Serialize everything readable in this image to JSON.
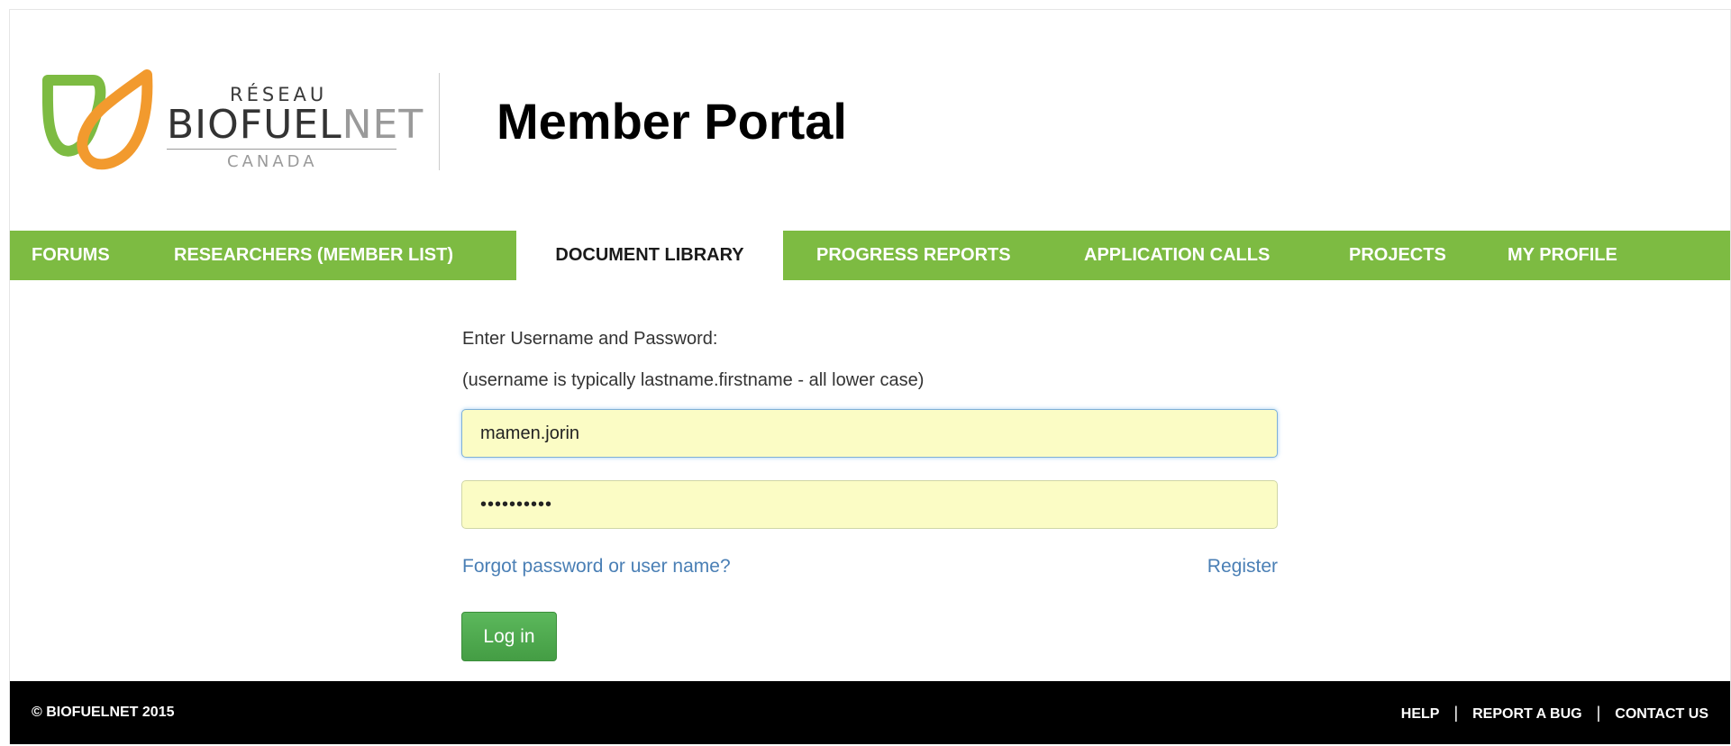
{
  "header": {
    "logo": {
      "reseau": "RÉSEAU",
      "brand_main": "BIOFUEL",
      "brand_net": "NET",
      "canada": "CANADA",
      "colors": {
        "green": "#7dbb42",
        "orange": "#f29a2e"
      }
    },
    "title": "Member Portal"
  },
  "nav": {
    "color": "#7dbb42",
    "items": [
      {
        "label": "FORUMS",
        "active": false
      },
      {
        "label": "RESEARCHERS (MEMBER LIST)",
        "active": false
      },
      {
        "label": "DOCUMENT LIBRARY",
        "active": true
      },
      {
        "label": "PROGRESS REPORTS",
        "active": false
      },
      {
        "label": "APPLICATION CALLS",
        "active": false
      },
      {
        "label": "PROJECTS",
        "active": false
      },
      {
        "label": "MY PROFILE",
        "active": false
      }
    ]
  },
  "login": {
    "prompt": "Enter Username and Password:",
    "hint": "(username is typically lastname.firstname - all lower case)",
    "username_value": "mamen.jorin",
    "password_value": "••••••••••",
    "forgot_link": "Forgot password or user name?",
    "register_link": "Register",
    "login_button": "Log in"
  },
  "footer": {
    "copyright": "© BIOFUELNET 2015",
    "links": [
      "HELP",
      "REPORT A BUG",
      "CONTACT US"
    ]
  }
}
